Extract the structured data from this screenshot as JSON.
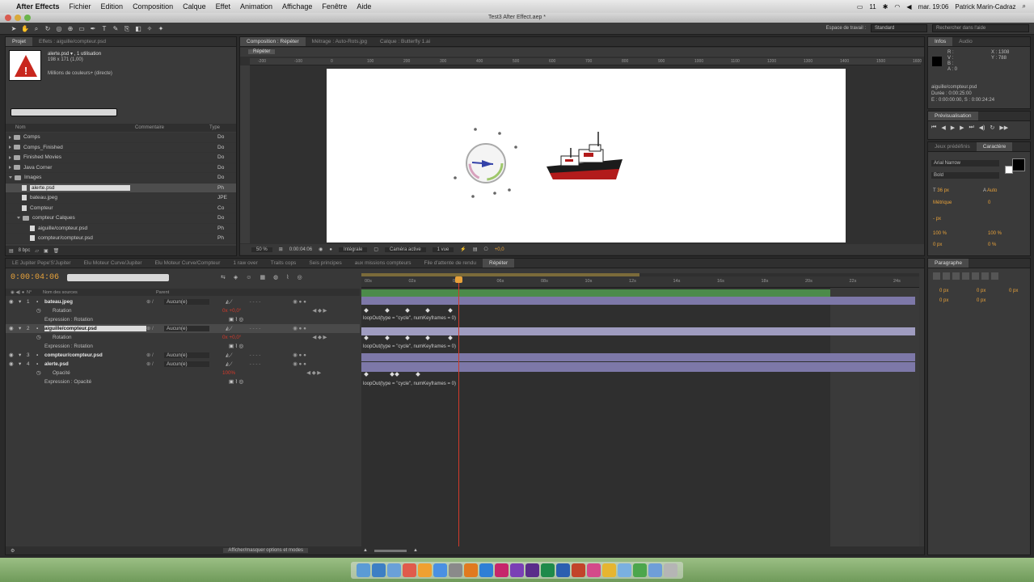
{
  "menubar": {
    "apple": "",
    "app_name": "After Effects",
    "items": [
      "Fichier",
      "Edition",
      "Composition",
      "Calque",
      "Effet",
      "Animation",
      "Affichage",
      "Fenêtre",
      "Aide"
    ],
    "status_battery": "11",
    "clock": "mar. 19:06",
    "user": "Patrick Marin-Cadraz"
  },
  "window_title": "Test3 After Effect.aep *",
  "toolbar": {
    "workspace_label": "Espace de travail :",
    "workspace_value": "Standard",
    "help_search_placeholder": "Rechercher dans l'aide"
  },
  "project": {
    "tabs": [
      "Projet",
      "Effets : aiguille/compteur.psd"
    ],
    "selected_name": "alerte.psd ▾ , 1 utilisation",
    "selected_size": "198 x 171 (1,00)",
    "selected_colors": "Millions de couleurs+ (directe)",
    "search_placeholder": "",
    "columns": [
      "Nom",
      "Commentaire",
      "Type"
    ],
    "items": [
      {
        "name": "Comps",
        "type": "Do",
        "kind": "folder",
        "indent": 0
      },
      {
        "name": "Comps_Finished",
        "type": "Do",
        "kind": "folder",
        "indent": 0
      },
      {
        "name": "Finished Movies",
        "type": "Do",
        "kind": "folder",
        "indent": 0
      },
      {
        "name": "Java Corner",
        "type": "Do",
        "kind": "folder",
        "indent": 0
      },
      {
        "name": "Images",
        "type": "Do",
        "kind": "folder-open",
        "indent": 0
      },
      {
        "name": "alerte.psd",
        "type": "Ph",
        "kind": "file",
        "indent": 1,
        "selected": true
      },
      {
        "name": "bateau.jpeg",
        "type": "JPE",
        "kind": "file",
        "indent": 1
      },
      {
        "name": "Compteur",
        "type": "Co",
        "kind": "file",
        "indent": 1
      },
      {
        "name": "compteur Calques",
        "type": "Do",
        "kind": "folder-open",
        "indent": 1
      },
      {
        "name": "aiguille/compteur.psd",
        "type": "Ph",
        "kind": "file",
        "indent": 2
      },
      {
        "name": "compteur/compteur.psd",
        "type": "Ph",
        "kind": "file",
        "indent": 2
      }
    ],
    "bpc": "8 bpc"
  },
  "composition": {
    "tabs": [
      "Composition : Répéter",
      "Métrage : Auto-Rots.jpg",
      "Calque : Butterfly 1.ai"
    ],
    "breadcrumb": "Répéter",
    "ruler_ticks": [
      "-200",
      "-100",
      "0",
      "100",
      "200",
      "300",
      "400",
      "500",
      "600",
      "700",
      "800",
      "900",
      "1000",
      "1100",
      "1200",
      "1300",
      "1400",
      "1500",
      "1600"
    ],
    "zoom": "50 %",
    "timecode": "0:00:04:06",
    "quality": "Intégrale",
    "camera": "Caméra active",
    "views": "1 vue",
    "offset": "+0,0"
  },
  "info_panel": {
    "tabs": [
      "Infos",
      "Audio"
    ],
    "rgb": [
      "R :",
      "V :",
      "B :",
      "A : 0"
    ],
    "xy": [
      "X : 1308",
      "Y : 788"
    ],
    "layer_name": "aiguille/compteur.psd",
    "duration": "Durée : 0:00:25:00",
    "range": "E : 0:00:00:00, S : 0:00:24:24"
  },
  "preview_panel": {
    "tab": "Prévisualisation"
  },
  "character_panel": {
    "tabs": [
      "Jeux prédéfinis",
      "Caractère"
    ],
    "font": "Arial Narrow",
    "style": "Bold",
    "size": "36 px",
    "leading": "Auto",
    "metrics": "Métrique",
    "tracking": "0",
    "stroke": "- px",
    "vscale": "100 %",
    "hscale": "100 %",
    "baseline": "0 px",
    "tsume": "0 %"
  },
  "paragraph_panel": {
    "tab": "Paragraphe",
    "fields": [
      "0 px",
      "0 px",
      "0 px",
      "0 px",
      "0 px"
    ]
  },
  "timeline": {
    "tabs": [
      "LE Jupiter Pepe'S'Jupiter",
      "Elu Moteur Curve/Jupiter",
      "Elu Moteur Curve/Compteur",
      "1 raw over",
      "Traits cops",
      "Seis principes",
      "aux missions compteurs",
      "File d'attente de rendu",
      "Répéter"
    ],
    "timecode": "0:00:04:06",
    "search_placeholder": "",
    "header_cols": [
      "N°",
      "Nom des sources",
      "Parent"
    ],
    "ruler": [
      "00s",
      "02s",
      "04s",
      "06s",
      "08s",
      "10s",
      "12s",
      "14s",
      "16s",
      "18s",
      "20s",
      "22s",
      "24s"
    ],
    "layers": [
      {
        "num": "1",
        "name": "bateau.jpeg",
        "parent": "Aucun(e)"
      },
      {
        "prop": "Rotation",
        "value": "0x +0,0°"
      },
      {
        "expr_label": "Expression : Rotation",
        "expr": "loopOut(type = \"cycle\", numKeyframes = 0)"
      },
      {
        "num": "2",
        "name": "aiguille/compteur.psd",
        "parent": "Aucun(e)",
        "selected": true
      },
      {
        "prop": "Rotation",
        "value": "0x +0,0°"
      },
      {
        "expr_label": "Expression : Rotation",
        "expr": "loopOut(type = \"cycle\", numKeyframes = 0)"
      },
      {
        "num": "3",
        "name": "compteur/compteur.psd",
        "parent": "Aucun(e)"
      },
      {
        "num": "4",
        "name": "alerte.psd",
        "parent": "Aucun(e)"
      },
      {
        "prop": "Opacité",
        "value": "100%"
      },
      {
        "expr_label": "Expression : Opacité",
        "expr": "loopOut(type = \"cycle\", numKeyframes = 0)"
      }
    ],
    "footer": "Afficher/masquer options et modes",
    "playhead_seconds": 4.25,
    "duration_seconds": 25
  },
  "colors": {
    "accent_orange": "#e8a23a",
    "playhead_red": "#d23a2a",
    "layer_bar_green": "#4c8b4a",
    "layer_bar_violet": "#7d78a8",
    "layer_bar_lavender": "#9f9cc0"
  },
  "dock": {
    "icons": [
      "finder-icon",
      "safari-icon",
      "mail-icon",
      "calendar-icon",
      "ibooks-icon",
      "appstore-icon",
      "systemprefs-icon",
      "illustrator-icon",
      "photoshop-icon",
      "indesign-icon",
      "aftereffects-icon",
      "premiere-icon",
      "excel-icon",
      "word-icon",
      "powerpoint-icon",
      "itunes-icon",
      "photos-icon",
      "preview-icon",
      "chrome-icon",
      "folder-icon",
      "trash-icon"
    ]
  }
}
